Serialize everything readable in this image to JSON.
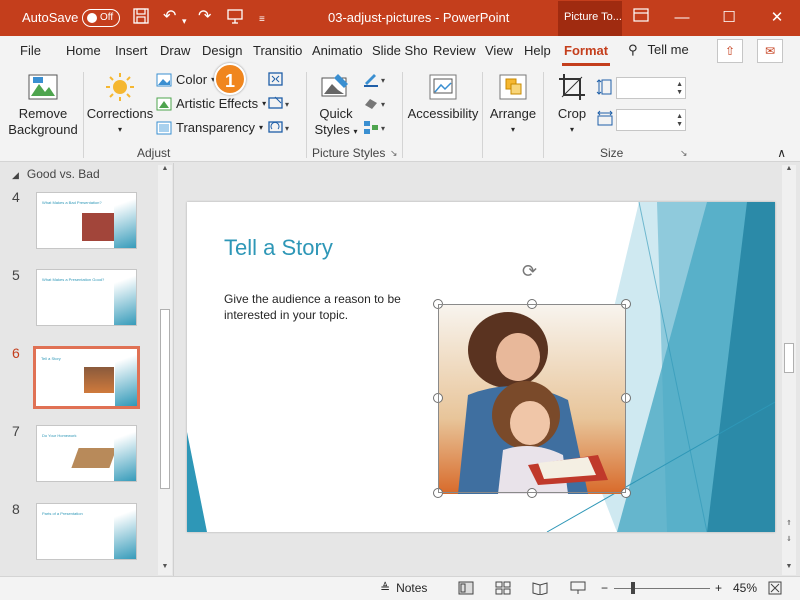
{
  "titlebar": {
    "autosave_label": "AutoSave",
    "autosave_state": "Off",
    "document_title": "03-adjust-pictures  -  PowerPoint",
    "context_tab": "Picture To..."
  },
  "tabs": [
    "File",
    "Home",
    "Insert",
    "Draw",
    "Design",
    "Transitio",
    "Animatio",
    "Slide Sho",
    "Review",
    "View",
    "Help",
    "Format"
  ],
  "active_tab": "Format",
  "tell_me": "Tell me",
  "ribbon": {
    "remove_background": "Remove Background",
    "corrections": "Corrections",
    "color": "Color",
    "artistic_effects": "Artistic Effects",
    "transparency": "Transparency",
    "adjust_group": "Adjust",
    "quick_styles": "Quick Styles",
    "picture_styles_group": "Picture Styles",
    "accessibility": "Accessibility",
    "arrange": "Arrange",
    "crop": "Crop",
    "size_group": "Size",
    "height_value": "",
    "width_value": ""
  },
  "thumbnails": {
    "section": "Good vs. Bad",
    "slides": [
      {
        "number": "4",
        "title": "What Makes a Bad Presentation?"
      },
      {
        "number": "5",
        "title": "What Makes a Presentation Good?"
      },
      {
        "number": "6",
        "title": "Tell a Story"
      },
      {
        "number": "7",
        "title": "Do Your Homework"
      },
      {
        "number": "8",
        "title": "Parts of a Presentation"
      }
    ],
    "selected": "6"
  },
  "slide": {
    "title": "Tell a Story",
    "body": "Give the audience a reason to be interested in your topic."
  },
  "callout": "1",
  "status": {
    "notes": "Notes",
    "zoom": "45%"
  },
  "colors": {
    "brand": "#c43e1c",
    "accent": "#2e97b7",
    "callout": "#f0861e"
  }
}
